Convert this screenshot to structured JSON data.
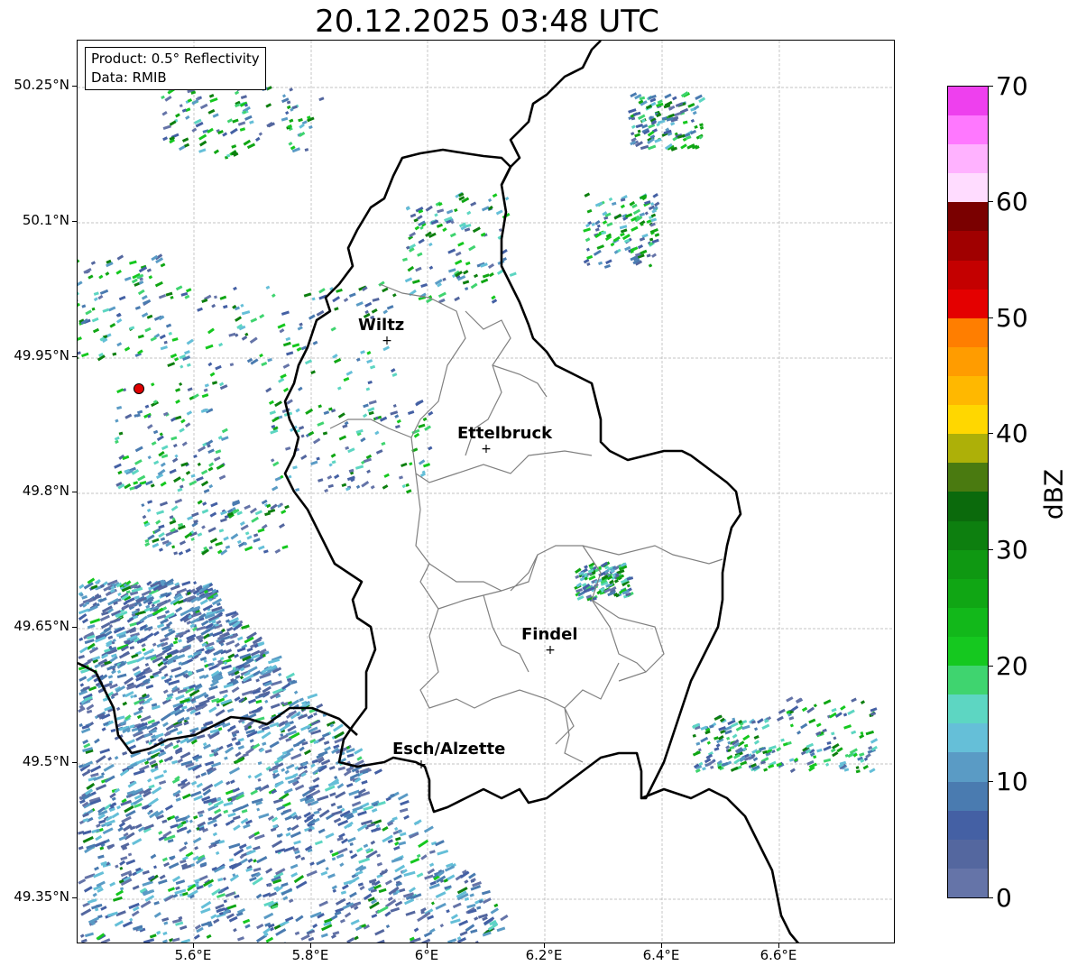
{
  "title": "20.12.2025 03:48 UTC",
  "info": {
    "product": "Product: 0.5° Reflectivity",
    "data": "Data: RMIB"
  },
  "lat_ticks": [
    "50.25°N",
    "50.1°N",
    "49.95°N",
    "49.8°N",
    "49.65°N",
    "49.5°N",
    "49.35°N"
  ],
  "lon_ticks": [
    "5.6°E",
    "5.8°E",
    "6°E",
    "6.2°E",
    "6.4°E",
    "6.6°E"
  ],
  "cities": [
    {
      "name": "Wiltz"
    },
    {
      "name": "Ettelbruck"
    },
    {
      "name": "Findel"
    },
    {
      "name": "Esch/Alzette"
    }
  ],
  "marker_glyph": "+",
  "colorbar": {
    "unit": "dBZ",
    "labels": [
      "0",
      "10",
      "20",
      "30",
      "40",
      "50",
      "60",
      "70"
    ],
    "colors": [
      "#6574a8",
      "#54679f",
      "#4460a4",
      "#4a7bb0",
      "#5a9bc5",
      "#65bfd8",
      "#5dd6c2",
      "#3fd46f",
      "#15c81f",
      "#12b81a",
      "#10a614",
      "#0f9812",
      "#0d7f0f",
      "#0b6a0c",
      "#4a7a10",
      "#adb008",
      "#ffd700",
      "#ffb800",
      "#ff9c00",
      "#ff7e00",
      "#e40000",
      "#c40000",
      "#a00000",
      "#7a0000",
      "#ffdcff",
      "#ffb2ff",
      "#ff78ff",
      "#ee40ee"
    ]
  },
  "colors": {
    "border": "#000000",
    "canton_lines": "#808080",
    "grid": "#b0b0b0",
    "radar_site": "#e00000"
  }
}
